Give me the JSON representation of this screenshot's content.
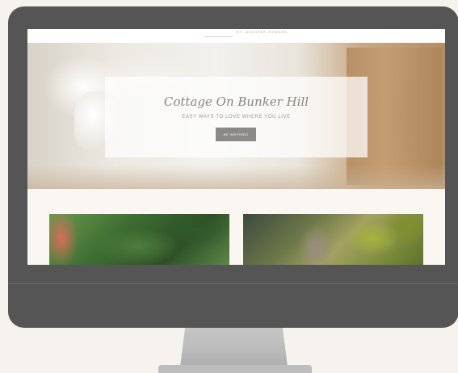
{
  "site": {
    "logo_subtitle": "BY JENNIFER HOWARD",
    "hero": {
      "title": "Cottage On Bunker Hill",
      "tagline": "EASY WAYS TO LOVE WHERE YOU LIVE",
      "button_label": "BE INSPIRED"
    }
  },
  "colors": {
    "monitor": "#555556",
    "screen_background": "#faf6f1",
    "button": "#8c8a88"
  }
}
